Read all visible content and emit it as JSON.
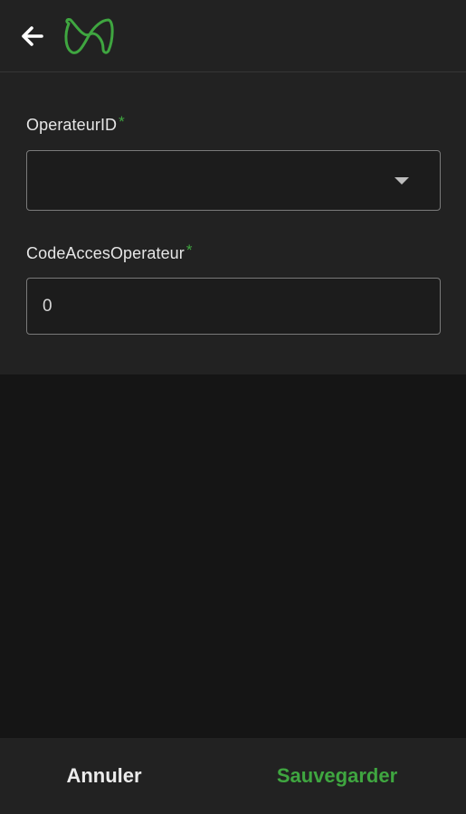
{
  "header": {
    "back_icon": "arrow-left-icon",
    "logo_icon": "brand-logo-icon",
    "accent_color": "#3fa640"
  },
  "form": {
    "fields": [
      {
        "label": "OperateurID",
        "required_mark": "*",
        "type": "select",
        "value": ""
      },
      {
        "label": "CodeAccesOperateur",
        "required_mark": "*",
        "type": "text",
        "value": "0"
      }
    ]
  },
  "footer": {
    "cancel_label": "Annuler",
    "save_label": "Sauvegarder"
  }
}
